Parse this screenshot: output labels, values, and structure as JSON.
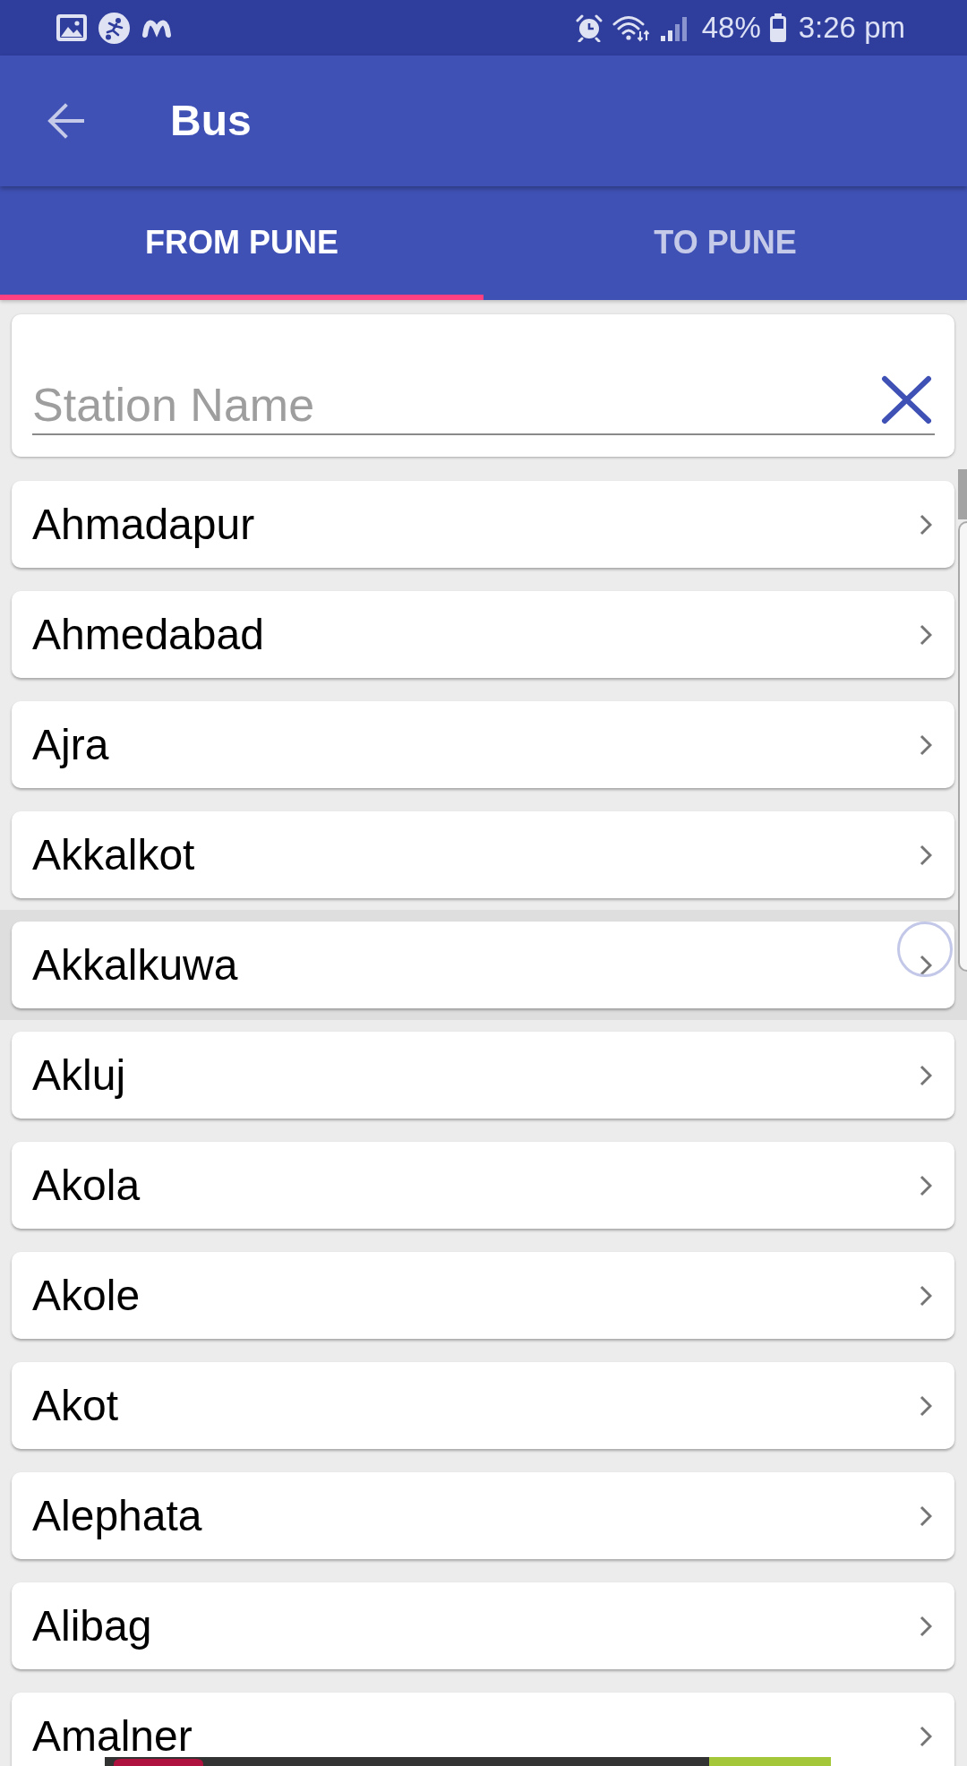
{
  "status_bar": {
    "battery": "48%",
    "time": "3:26 pm"
  },
  "app_bar": {
    "title": "Bus"
  },
  "tabs": [
    {
      "label": "FROM PUNE",
      "selected": true
    },
    {
      "label": "TO PUNE",
      "selected": false
    }
  ],
  "search": {
    "placeholder": "Station Name"
  },
  "stations": [
    {
      "name": "Ahmadapur",
      "pressed": false
    },
    {
      "name": "Ahmedabad",
      "pressed": false
    },
    {
      "name": "Ajra",
      "pressed": false
    },
    {
      "name": "Akkalkot",
      "pressed": false
    },
    {
      "name": "Akkalkuwa",
      "pressed": true
    },
    {
      "name": "Akluj",
      "pressed": false
    },
    {
      "name": "Akola",
      "pressed": false
    },
    {
      "name": "Akole",
      "pressed": false
    },
    {
      "name": "Akot",
      "pressed": false
    },
    {
      "name": "Alephata",
      "pressed": false
    },
    {
      "name": "Alibag",
      "pressed": false
    },
    {
      "name": "Amalner",
      "pressed": false
    }
  ]
}
